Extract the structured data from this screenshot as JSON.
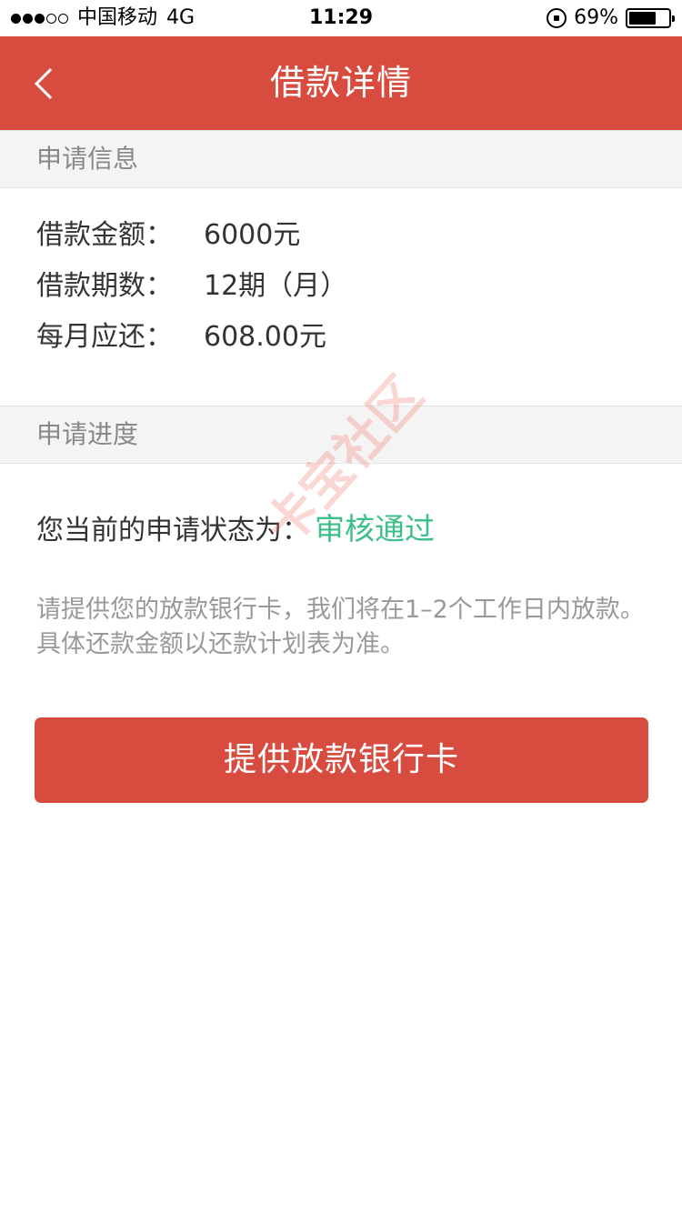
{
  "status_bar": {
    "carrier": "中国移动",
    "network": "4G",
    "time": "11:29",
    "battery_percent": "69%",
    "battery_level": 0.69,
    "signal_bars_filled": 3,
    "signal_bars_total": 5
  },
  "nav": {
    "title": "借款详情"
  },
  "application_info": {
    "header": "申请信息",
    "rows": [
      {
        "label": "借款金额：",
        "value": "6000元"
      },
      {
        "label": "借款期数：",
        "value": "12期（月）"
      },
      {
        "label": "每月应还：",
        "value": "608.00元"
      }
    ]
  },
  "application_progress": {
    "header": "申请进度",
    "status_label": "您当前的申请状态为：",
    "status_value": "审核通过",
    "status_color": "#3dbf8a",
    "notice": "请提供您的放款银行卡，我们将在1–2个工作日内放款。具体还款金额以还款计划表为准。"
  },
  "action": {
    "button_label": "提供放款银行卡"
  },
  "watermark": {
    "text": "卡宝社区"
  },
  "colors": {
    "brand": "#d84c40"
  }
}
